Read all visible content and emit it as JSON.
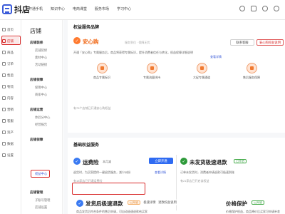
{
  "app": {
    "logo_text": "抖店"
  },
  "topnav": [
    "开通手机",
    "知识中心",
    "电商课堂",
    "服务市场",
    "学习中心"
  ],
  "sidebar": {
    "items": [
      {
        "label": "首页"
      },
      {
        "label": "店铺"
      },
      {
        "label": "商品"
      },
      {
        "label": "订单"
      },
      {
        "label": "售后"
      },
      {
        "label": "物流"
      },
      {
        "label": "内容"
      },
      {
        "label": "营销"
      },
      {
        "label": "客服"
      },
      {
        "label": "资产"
      },
      {
        "label": "数据"
      },
      {
        "label": "设置"
      }
    ]
  },
  "subnav": {
    "title": "店铺",
    "groups": [
      {
        "name": "店铺装修",
        "links": [
          "店铺装修",
          "素材中心",
          "活动链接"
        ]
      },
      {
        "name": "店铺保障",
        "links": [
          "保障中心",
          "商家中心"
        ]
      },
      {
        "name": "店铺运营",
        "links": [
          "体验分中心",
          "经营报告"
        ]
      },
      {
        "name": "店铺保障",
        "links": [
          "权益中心"
        ]
      },
      {
        "name": "店铺管理",
        "links": [
          "子账号管理",
          "店铺设置"
        ]
      }
    ]
  },
  "rights": {
    "title": "权益服务品牌",
    "sub": "服务到位 · 保障无忧",
    "brand": "安心购",
    "desc": "开通「安心购」专属服务后，商品将获得专属标识，提升消费者信任与转化，权益保障详细说明",
    "link": "查看详情",
    "btn_a": "联系客服",
    "btn_b": "安心购权益说明",
    "features": [
      "商品专属标识",
      "专属流量扶持",
      "大促专属通道",
      "售后服务保障"
    ],
    "footer": "有75个店铺已开通安心购权益"
  },
  "basic": {
    "title": "基础权益服务"
  },
  "freight": {
    "title": "运费险",
    "tag": "本月减",
    "desc": "退货时，为买家提供一键退货服务，减少纠纷",
    "link": "查看详情",
    "btn": "立即开通",
    "footer": "有18家店已开通运费险"
  },
  "nodelivery": {
    "title": "未发货极速退款",
    "tag": "已开启",
    "desc": "订单未发货时，消费者申请退款可极速到账",
    "footer": "有21家店已开启该权益"
  },
  "fastrefund": {
    "title": "发货后极速退款",
    "tag": "已开启",
    "btn_a": "极速详情",
    "btn_b": "退款权益说明",
    "desc": "商品发货后符合条件的售后申请，可自动极速退款给买家"
  },
  "price": {
    "title": "价格保护",
    "tag": "已开启",
    "desc": "价格保护权益，商品降价后买家可申请补差"
  }
}
